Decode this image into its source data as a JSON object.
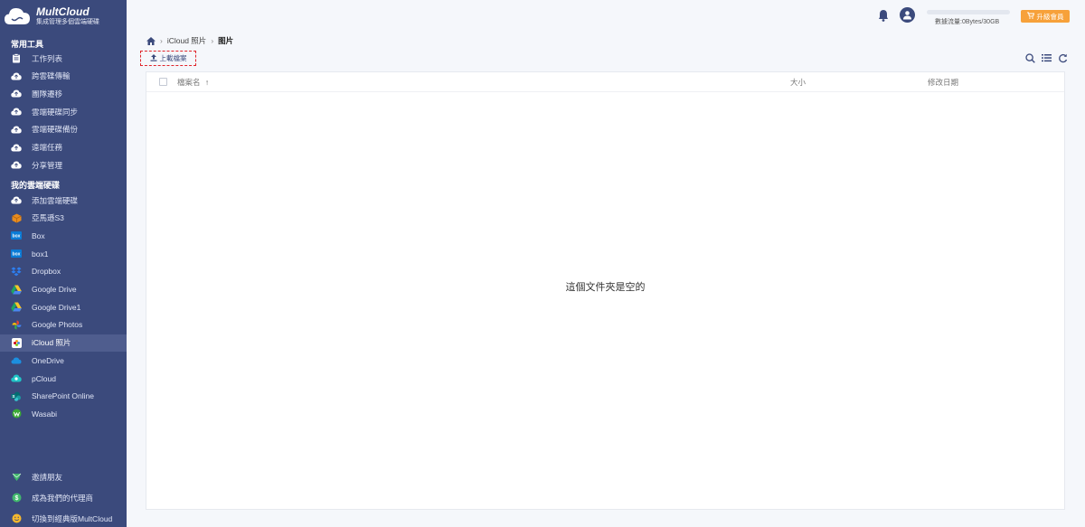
{
  "brand": {
    "name": "MultCloud",
    "tagline": "集成管理多個雲端硬碟"
  },
  "sidebar": {
    "tools_title": "常用工具",
    "tools": [
      {
        "label": "工作列表",
        "icon": "clipboard-icon"
      },
      {
        "label": "跨雲碟傳輸",
        "icon": "cloud-transfer-icon"
      },
      {
        "label": "團隊遷移",
        "icon": "cloud-team-icon"
      },
      {
        "label": "雲端硬碟同步",
        "icon": "cloud-sync-icon"
      },
      {
        "label": "雲端硬碟備份",
        "icon": "cloud-backup-icon"
      },
      {
        "label": "遠端任務",
        "icon": "cloud-upload-icon"
      },
      {
        "label": "分享管理",
        "icon": "cloud-share-icon"
      }
    ],
    "drives_title": "我的雲端硬碟",
    "drives": [
      {
        "label": "添加雲端硬碟",
        "icon": "cloud-add-icon"
      },
      {
        "label": "亞馬遜S3",
        "icon": "amazon-s3-icon"
      },
      {
        "label": "Box",
        "icon": "box-icon"
      },
      {
        "label": "box1",
        "icon": "box-icon"
      },
      {
        "label": "Dropbox",
        "icon": "dropbox-icon"
      },
      {
        "label": "Google Drive",
        "icon": "google-drive-icon"
      },
      {
        "label": "Google Drive1",
        "icon": "google-drive-icon"
      },
      {
        "label": "Google Photos",
        "icon": "google-photos-icon"
      },
      {
        "label": "iCloud 照片",
        "icon": "icloud-photos-icon",
        "active": true
      },
      {
        "label": "OneDrive",
        "icon": "onedrive-icon"
      },
      {
        "label": "pCloud",
        "icon": "pcloud-icon"
      },
      {
        "label": "SharePoint Online",
        "icon": "sharepoint-icon"
      },
      {
        "label": "Wasabi",
        "icon": "wasabi-icon"
      }
    ],
    "bottom": [
      {
        "label": "邀請朋友",
        "icon": "gift-icon"
      },
      {
        "label": "成為我們的代理商",
        "icon": "dollar-icon"
      },
      {
        "label": "切換到經典版MultCloud",
        "icon": "smile-icon"
      }
    ]
  },
  "topbar": {
    "traffic": "數據流量:0Bytes/30GB",
    "upgrade": "升級會員"
  },
  "breadcrumb": {
    "parent": "iCloud 照片",
    "current": "图片"
  },
  "toolbar": {
    "upload": "上載檔案"
  },
  "table": {
    "col_name": "檔案名",
    "sort_arrow": "↑",
    "col_size": "大小",
    "col_date": "修改日期"
  },
  "empty_text": "這個文件夾是空的",
  "colors": {
    "sidebar": "#3b4a7c",
    "accent": "#f7a13a",
    "dashed": "#e0242a"
  }
}
